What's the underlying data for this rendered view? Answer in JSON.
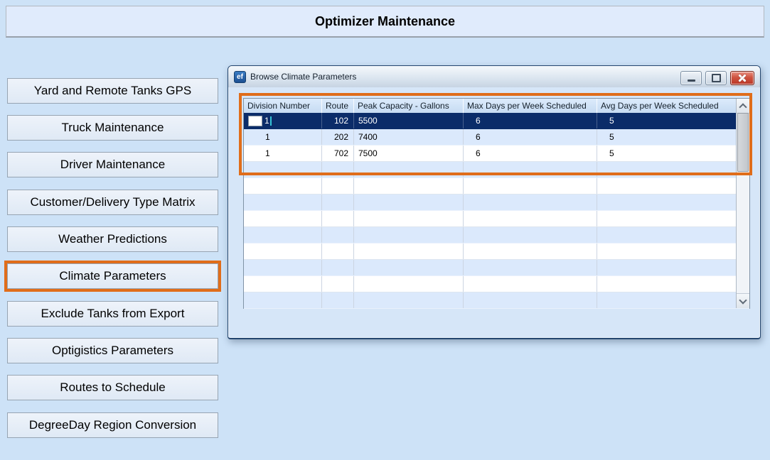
{
  "banner": {
    "title": "Optimizer Maintenance"
  },
  "sidebar": {
    "items": [
      "Yard and Remote Tanks GPS",
      "Truck Maintenance",
      "Driver Maintenance",
      "Customer/Delivery Type Matrix",
      "Weather Predictions",
      "Climate Parameters",
      "Exclude Tanks from Export",
      "Optigistics Parameters",
      "Routes to Schedule",
      "DegreeDay Region Conversion"
    ],
    "highlighted_item": "Climate Parameters"
  },
  "window": {
    "icon_label": "ef",
    "title": "Browse Climate Parameters",
    "controls": [
      "minimize-icon",
      "maximize-icon",
      "close-icon"
    ]
  },
  "grid": {
    "columns": [
      "Division Number",
      "Route",
      "Peak Capacity - Gallons",
      "Max Days per Week Scheduled",
      "Avg Days per Week Scheduled"
    ],
    "rows": [
      [
        "1",
        "102",
        "5500",
        "6",
        "5"
      ],
      [
        "1",
        "202",
        "7400",
        "6",
        "5"
      ],
      [
        "1",
        "702",
        "7500",
        "6",
        "5"
      ]
    ],
    "selected_row_index": 0,
    "selected_cell_has_edit_box": true,
    "empty_row_count": 9,
    "scrollbar_icons": [
      "chevron-up-icon",
      "chevron-down-icon"
    ]
  },
  "colors": {
    "highlight_orange": "#e06d1a",
    "selected_row": "#0b2c69",
    "alternate_row": "#dbe9fc",
    "header_background": "#cfe0f4",
    "page_background": "#cde2f7",
    "close_button_red": "#b93726"
  }
}
